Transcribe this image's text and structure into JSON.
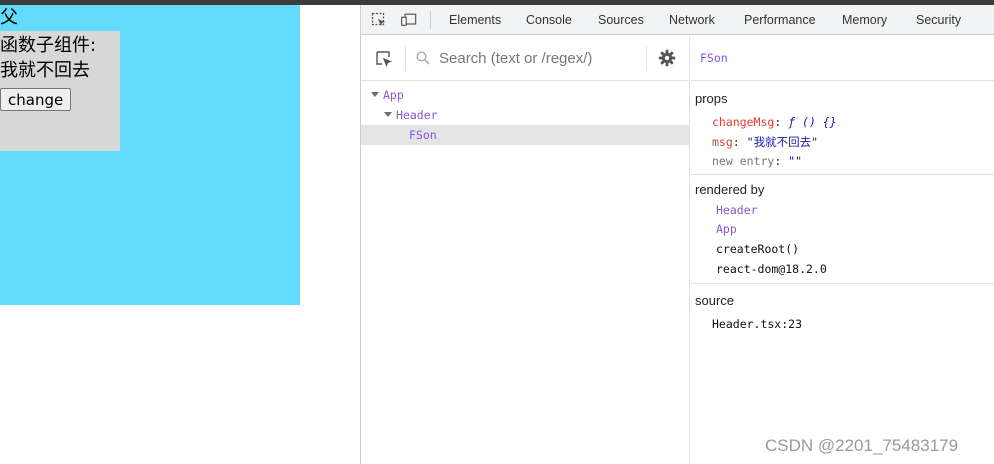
{
  "app": {
    "parent_label": "父",
    "child_title": "函数子组件:",
    "child_msg": "我就不回去",
    "change_button": "change",
    "colors": {
      "parent_bg": "#61dafb",
      "child_bg": "#d8d8d8"
    }
  },
  "devtools": {
    "icons": [
      "inspect-element-icon",
      "device-toolbar-icon"
    ],
    "tabs": [
      "Elements",
      "Console",
      "Sources",
      "Network",
      "Performance",
      "Memory",
      "Security"
    ],
    "search": {
      "placeholder": "Search (text or /regex/)"
    },
    "tree": [
      {
        "label": "App",
        "expanded": true
      },
      {
        "label": "Header",
        "expanded": true
      },
      {
        "label": "FSon",
        "selected": true
      }
    ],
    "selected_component": "FSon",
    "props": {
      "title": "props",
      "items": [
        {
          "key": "changeMsg",
          "value": "ƒ () {}"
        },
        {
          "key": "msg",
          "value": "\"我就不回去\""
        }
      ],
      "new_entry_key": "new entry",
      "new_entry_value": "\"\""
    },
    "rendered_by": {
      "title": "rendered by",
      "owners": [
        "Header",
        "App"
      ],
      "others": [
        "createRoot()",
        "react-dom@18.2.0"
      ]
    },
    "source": {
      "title": "source",
      "location": "Header.tsx:23"
    }
  },
  "watermark": "CSDN @2201_75483179"
}
